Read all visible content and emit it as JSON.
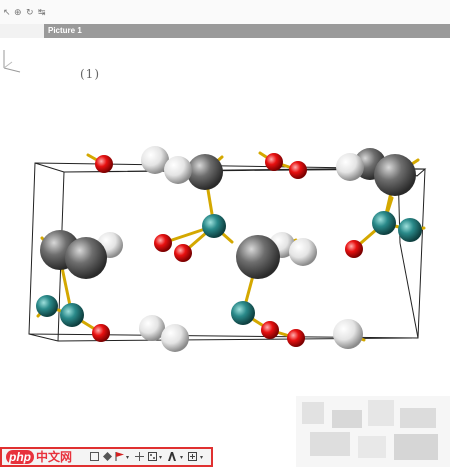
{
  "window": {
    "tab_title": "Picture 1",
    "lattice_label": "(1)"
  },
  "toolbar": {
    "logo_php": "php",
    "logo_cn": "中文网",
    "icons": [
      "square-icon",
      "diamond-icon",
      "flag-icon",
      "pan-icon",
      "dotted-grid-icon",
      "text-label-icon",
      "crosshair-icon"
    ]
  },
  "colors": {
    "tab_active": "#9a9a9a",
    "tab_bar": "#b8b8b8",
    "oxygen": "#e81010",
    "metal": "#2a8a8a",
    "heavy_atom": "#6e6e6e",
    "light_atom": "#e4e4e4",
    "bond": "#d4a800",
    "toolbar_border": "#e03030"
  }
}
